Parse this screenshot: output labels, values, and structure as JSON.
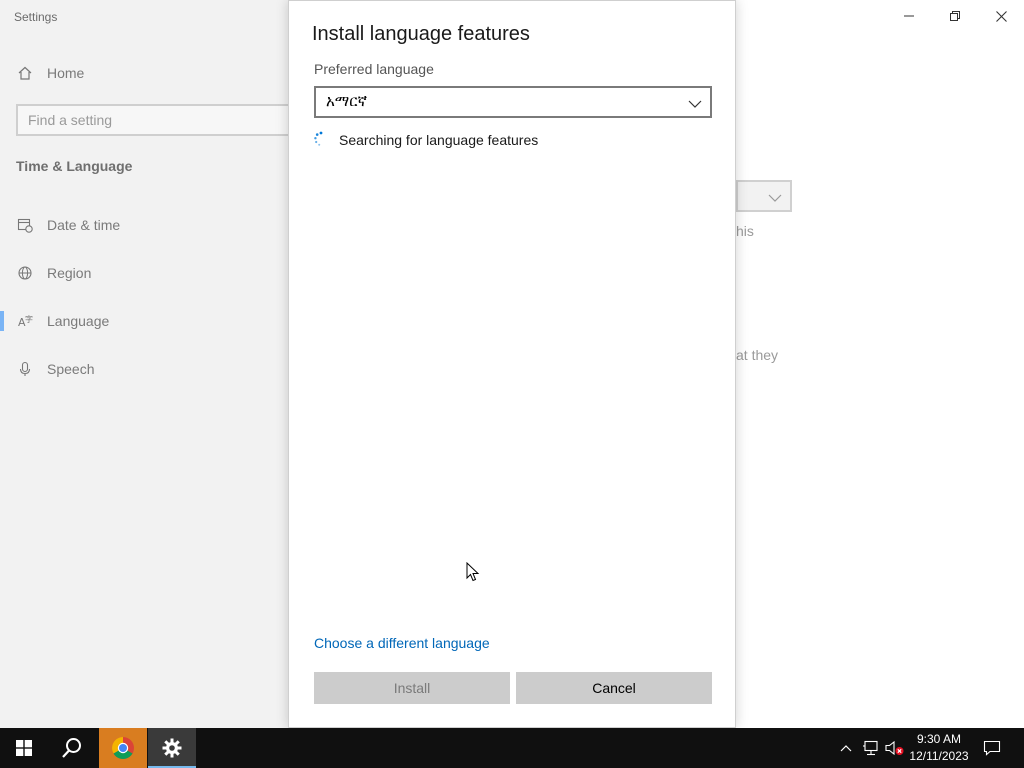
{
  "window": {
    "app_title": "Settings",
    "controls": {
      "minimize": "minimize",
      "restore": "restore",
      "close": "close"
    }
  },
  "sidebar": {
    "home_label": "Home",
    "search_placeholder": "Find a setting",
    "section_title": "Time & Language",
    "items": [
      {
        "label": "Date & time",
        "icon": "calendar-clock-icon"
      },
      {
        "label": "Region",
        "icon": "globe-icon"
      },
      {
        "label": "Language",
        "icon": "language-icon",
        "active": true
      },
      {
        "label": "Speech",
        "icon": "microphone-icon"
      }
    ]
  },
  "background": {
    "text_fragment_1": "his",
    "text_fragment_2": "at they"
  },
  "dialog": {
    "title": "Install language features",
    "preferred_label": "Preferred language",
    "selected_language": "አማርኛ",
    "status_text": "Searching for language features",
    "different_language_link": "Choose a different language",
    "install_label": "Install",
    "cancel_label": "Cancel"
  },
  "taskbar": {
    "time": "9:30 AM",
    "date": "12/11/2023"
  },
  "colors": {
    "accent": "#0067b8",
    "active_indicator": "#7ab4f5",
    "taskbar": "#101010",
    "chrome_highlight": "#d97d20"
  }
}
